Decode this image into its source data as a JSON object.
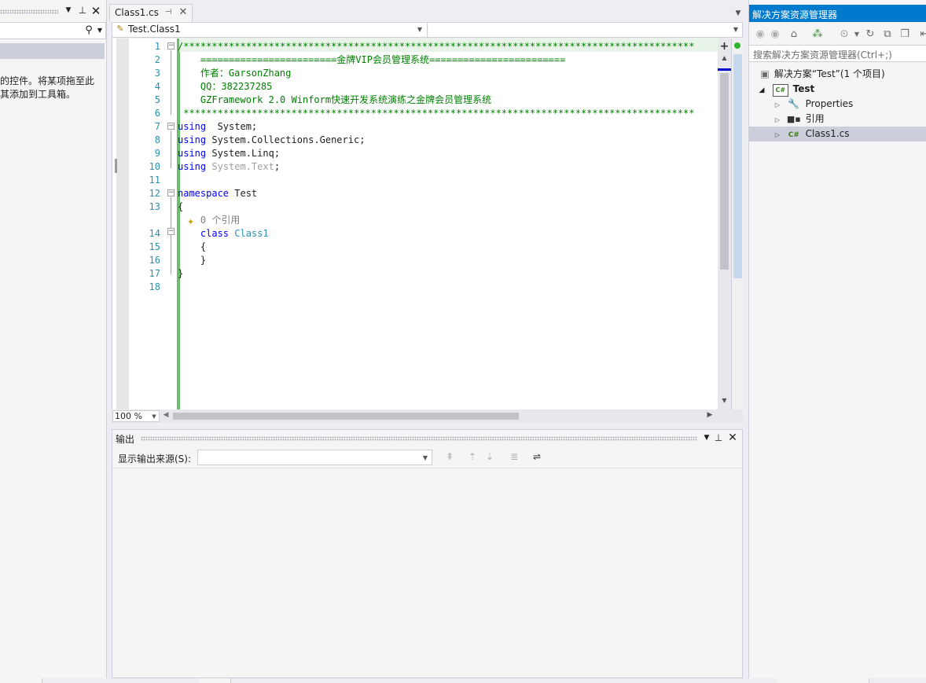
{
  "toolbox": {
    "search_placeholder": "",
    "hint_line1": "的控件。将某项拖至此",
    "hint_line2": "其添加到工具箱。"
  },
  "editor": {
    "tab_label": "Class1.cs",
    "nav_left": "Test.Class1",
    "nav_right": "",
    "zoom": "100 %",
    "lines": [
      {
        "n": "1",
        "parts": [
          [
            "cm",
            "/******************************************************************************************"
          ]
        ]
      },
      {
        "n": "2",
        "parts": [
          [
            "cm",
            "    ========================金牌VIP会员管理系统========================"
          ]
        ]
      },
      {
        "n": "3",
        "parts": [
          [
            "cm",
            "    作者：GarsonZhang"
          ]
        ]
      },
      {
        "n": "4",
        "parts": [
          [
            "cm",
            "    QQ：382237285"
          ]
        ]
      },
      {
        "n": "5",
        "parts": [
          [
            "cm",
            "    GZFramework 2.0 Winform快速开发系统演练之金牌会员管理系统"
          ]
        ]
      },
      {
        "n": "6",
        "parts": [
          [
            "cm",
            " ******************************************************************************************"
          ]
        ]
      },
      {
        "n": "7",
        "parts": [
          [
            "kw",
            "using"
          ],
          [
            "",
            "  System;"
          ]
        ]
      },
      {
        "n": "8",
        "parts": [
          [
            "kw",
            "using"
          ],
          [
            "",
            " System.Collections.Generic;"
          ]
        ]
      },
      {
        "n": "9",
        "parts": [
          [
            "kw",
            "using"
          ],
          [
            "",
            " System.Linq;"
          ]
        ]
      },
      {
        "n": "10",
        "parts": [
          [
            "kw",
            "using"
          ],
          [
            "dim",
            " System.Text"
          ],
          [
            "",
            ";"
          ]
        ]
      },
      {
        "n": "11",
        "parts": []
      },
      {
        "n": "12",
        "parts": [
          [
            "kw",
            "namespace"
          ],
          [
            "",
            " Test"
          ]
        ]
      },
      {
        "n": "13",
        "parts": [
          [
            "",
            "{"
          ]
        ]
      },
      {
        "n": "",
        "parts": [
          [
            "gr",
            "    0 个引用"
          ]
        ]
      },
      {
        "n": "14",
        "parts": [
          [
            "kw",
            "    class"
          ],
          [
            "ty",
            " Class1"
          ]
        ]
      },
      {
        "n": "15",
        "parts": [
          [
            "",
            "    {"
          ]
        ]
      },
      {
        "n": "16",
        "parts": [
          [
            "",
            "    }"
          ]
        ]
      },
      {
        "n": "17",
        "parts": [
          [
            "",
            "}"
          ]
        ]
      },
      {
        "n": "18",
        "parts": []
      }
    ]
  },
  "output": {
    "title": "输出",
    "source_label": "显示输出来源(S):",
    "source_value": ""
  },
  "solution_explorer": {
    "title": "解决方案资源管理器",
    "search_placeholder": "搜索解决方案资源管理器(Ctrl+;)",
    "solution_label": "解决方案“Test”(1 个项目)",
    "project_label": "Test",
    "items": [
      {
        "label": "Properties",
        "icon": "wrench-icon"
      },
      {
        "label": "引用",
        "icon": "references-icon"
      },
      {
        "label": "Class1.cs",
        "icon": "csharp-file-icon"
      }
    ]
  },
  "colors": {
    "accent": "#007acc",
    "comment": "#008000",
    "keyword": "#0000ff",
    "type": "#2b91af",
    "selection": "#cce8ff"
  }
}
